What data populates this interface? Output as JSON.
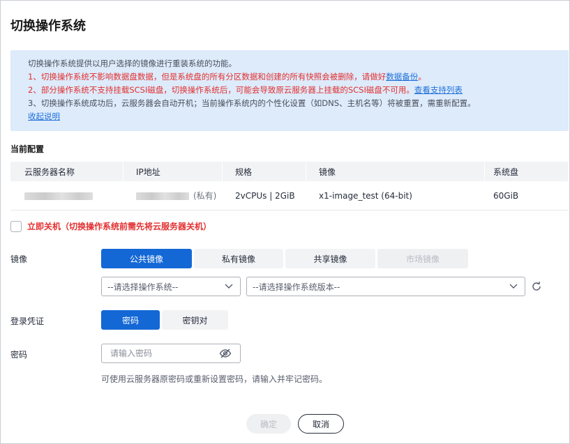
{
  "dialog": {
    "title": "切换操作系统"
  },
  "notice": {
    "intro": "切换操作系统提供以用户选择的镜像进行重装系统的功能。",
    "item1_text": "1、切换操作系统不影响数据盘数据，但是系统盘的所有分区数据和创建的所有快照会被删除，请做好",
    "item1_link": "数据备份",
    "item1_end": "。",
    "item2_text": "2、部分操作系统不支持挂载SCSI磁盘，切换操作系统后，可能会导致原云服务器上挂载的SCSI磁盘不可用。",
    "item2_link": "查看支持列表",
    "item3_text": "3、切换操作系统成功后，云服务器会自动开机；当前操作系统内的个性化设置（如DNS、主机名等）将被重置，需重新配置。",
    "collapse_link": "收起说明"
  },
  "current_config": {
    "label": "当前配置",
    "columns": [
      "云服务器名称",
      "IP地址",
      "规格",
      "镜像",
      "系统盘"
    ],
    "row": {
      "ip_suffix": "(私有)",
      "flavor": "2vCPUs | 2GiB",
      "image": "x1-image_test (64-bit)",
      "disk": "60GiB"
    }
  },
  "shutdown": {
    "label": "立即关机（切换操作系统前需先将云服务器关机）",
    "checked": false
  },
  "image": {
    "label": "镜像",
    "tabs": [
      "公共镜像",
      "私有镜像",
      "共享镜像",
      "市场镜像"
    ],
    "active_tab": 0,
    "disabled_tab": 3,
    "os_select_placeholder": "--请选择操作系统--",
    "version_select_placeholder": "--请选择操作系统版本--"
  },
  "credential": {
    "label": "登录凭证",
    "options": [
      "密码",
      "密钥对"
    ],
    "active": 0
  },
  "password": {
    "label": "密码",
    "placeholder": "请输入密码",
    "hint": "可使用云服务器原密码或重新设置密码，请输入并牢记密码。"
  },
  "footer": {
    "confirm": "确定",
    "cancel": "取消"
  },
  "colors": {
    "primary": "#1368d6",
    "danger": "#e2302f",
    "link": "#1f6fd9",
    "notice_bg": "#ddebfb"
  }
}
